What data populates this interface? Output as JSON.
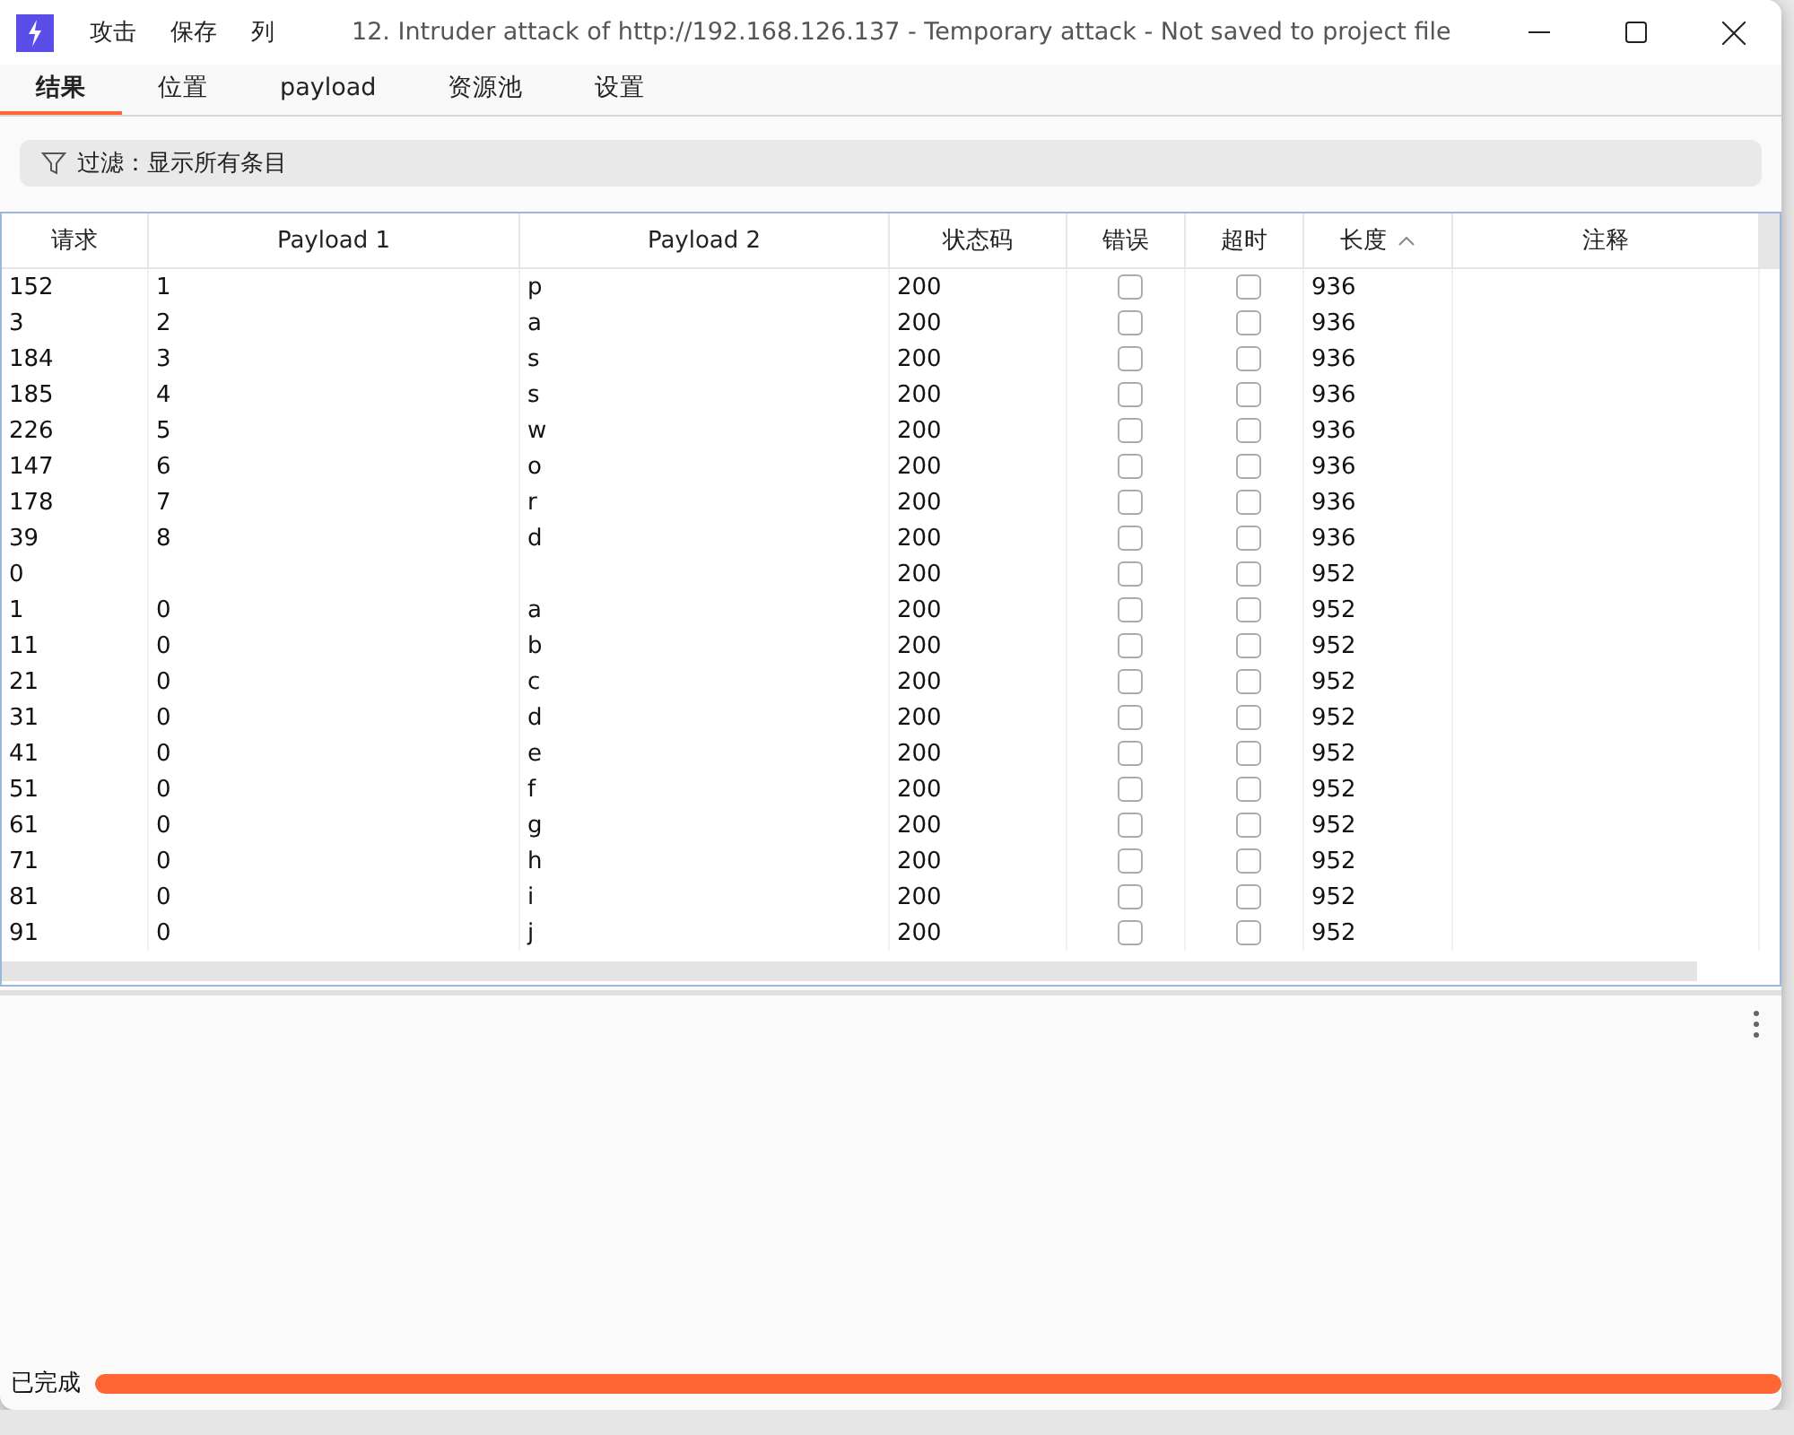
{
  "window": {
    "title": "12. Intruder attack of http://192.168.126.137 - Temporary attack - Not saved to project file"
  },
  "menu": [
    "攻击",
    "保存",
    "列"
  ],
  "tabs": [
    {
      "label": "结果",
      "selected": true
    },
    {
      "label": "位置",
      "selected": false
    },
    {
      "label": "payload",
      "selected": false
    },
    {
      "label": "资源池",
      "selected": false
    },
    {
      "label": "设置",
      "selected": false
    }
  ],
  "filter": {
    "label": "过滤：显示所有条目"
  },
  "table": {
    "columns": [
      {
        "label": "请求"
      },
      {
        "label": "Payload 1"
      },
      {
        "label": "Payload 2"
      },
      {
        "label": "状态码"
      },
      {
        "label": "错误"
      },
      {
        "label": "超时"
      },
      {
        "label": "长度",
        "sorted": true
      },
      {
        "label": "注释"
      }
    ],
    "rows": [
      {
        "request": "152",
        "payload_1": "1",
        "payload_2": "p",
        "status": "200",
        "error": false,
        "timeout": false,
        "length": "936"
      },
      {
        "request": "3",
        "payload_1": "2",
        "payload_2": "a",
        "status": "200",
        "error": false,
        "timeout": false,
        "length": "936"
      },
      {
        "request": "184",
        "payload_1": "3",
        "payload_2": "s",
        "status": "200",
        "error": false,
        "timeout": false,
        "length": "936"
      },
      {
        "request": "185",
        "payload_1": "4",
        "payload_2": "s",
        "status": "200",
        "error": false,
        "timeout": false,
        "length": "936"
      },
      {
        "request": "226",
        "payload_1": "5",
        "payload_2": "w",
        "status": "200",
        "error": false,
        "timeout": false,
        "length": "936"
      },
      {
        "request": "147",
        "payload_1": "6",
        "payload_2": "o",
        "status": "200",
        "error": false,
        "timeout": false,
        "length": "936"
      },
      {
        "request": "178",
        "payload_1": "7",
        "payload_2": "r",
        "status": "200",
        "error": false,
        "timeout": false,
        "length": "936"
      },
      {
        "request": "39",
        "payload_1": "8",
        "payload_2": "d",
        "status": "200",
        "error": false,
        "timeout": false,
        "length": "936"
      },
      {
        "request": "0",
        "status": "200",
        "error": false,
        "timeout": false,
        "length": "952"
      },
      {
        "request": "1",
        "payload_1": "0",
        "payload_2": "a",
        "status": "200",
        "error": false,
        "timeout": false,
        "length": "952"
      },
      {
        "request": "11",
        "payload_1": "0",
        "payload_2": "b",
        "status": "200",
        "error": false,
        "timeout": false,
        "length": "952"
      },
      {
        "request": "21",
        "payload_1": "0",
        "payload_2": "c",
        "status": "200",
        "error": false,
        "timeout": false,
        "length": "952"
      },
      {
        "request": "31",
        "payload_1": "0",
        "payload_2": "d",
        "status": "200",
        "error": false,
        "timeout": false,
        "length": "952"
      },
      {
        "request": "41",
        "payload_1": "0",
        "payload_2": "e",
        "status": "200",
        "error": false,
        "timeout": false,
        "length": "952"
      },
      {
        "request": "51",
        "payload_1": "0",
        "payload_2": "f",
        "status": "200",
        "error": false,
        "timeout": false,
        "length": "952"
      },
      {
        "request": "61",
        "payload_1": "0",
        "payload_2": "g",
        "status": "200",
        "error": false,
        "timeout": false,
        "length": "952"
      },
      {
        "request": "71",
        "payload_1": "0",
        "payload_2": "h",
        "status": "200",
        "error": false,
        "timeout": false,
        "length": "952"
      },
      {
        "request": "81",
        "payload_1": "0",
        "payload_2": "i",
        "status": "200",
        "error": false,
        "timeout": false,
        "length": "952"
      },
      {
        "request": "91",
        "payload_1": "0",
        "payload_2": "j",
        "status": "200",
        "error": false,
        "timeout": false,
        "length": "952"
      }
    ]
  },
  "status_bar": {
    "label": "已完成",
    "level": 1
  }
}
